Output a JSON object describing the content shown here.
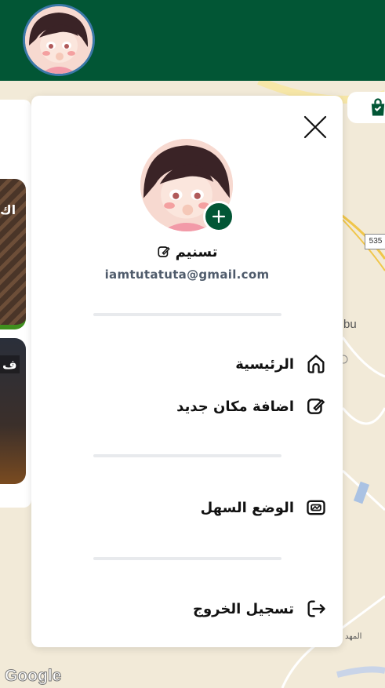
{
  "map": {
    "road_number": "535",
    "place_fragment": "bu",
    "place_fragment_2": "المهد",
    "attribution": "Google"
  },
  "cards": [
    {
      "label": "اك"
    },
    {
      "label": "ف"
    }
  ],
  "drawer": {
    "user_name": "تسنيم",
    "email": "iamtutatuta@gmail.com",
    "menu": [
      {
        "label": "الرئيسية",
        "icon": "home-icon"
      },
      {
        "label": "اضافة مكان جديد",
        "icon": "edit-icon"
      },
      {
        "label": "الوضع السهل",
        "icon": "image-mode-icon"
      },
      {
        "label": "تسجيل الخروج",
        "icon": "logout-icon"
      }
    ]
  },
  "colors": {
    "brand": "#025635",
    "map_bg": "#f2ead8",
    "avatar_ring": "#3b78a8"
  }
}
